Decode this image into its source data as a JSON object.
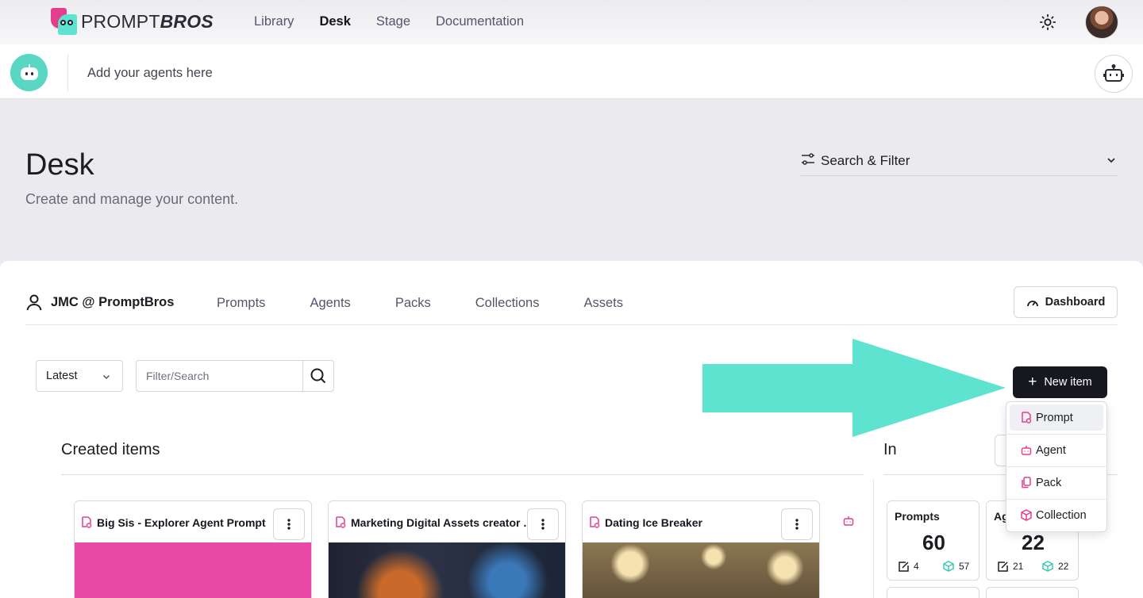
{
  "brand": {
    "name_light": "PROMPT",
    "name_bold": "BROS"
  },
  "nav": {
    "links": [
      "Library",
      "Desk",
      "Stage",
      "Documentation"
    ],
    "active": "Desk"
  },
  "agent_bar": {
    "placeholder": "Add your agents here"
  },
  "page": {
    "title": "Desk",
    "subtitle": "Create and manage your content."
  },
  "search_filter": {
    "label": "Search & Filter"
  },
  "owner": {
    "name": "JMC @ PromptBros"
  },
  "tabs": [
    "Prompts",
    "Agents",
    "Packs",
    "Collections",
    "Assets"
  ],
  "dashboard": {
    "label": "Dashboard"
  },
  "toolbar": {
    "sort_value": "Latest",
    "search_placeholder": "Filter/Search",
    "new_item_label": "New item"
  },
  "new_item_menu": {
    "items": [
      "Prompt",
      "Agent",
      "Pack",
      "Collection"
    ],
    "highlighted": "Prompt"
  },
  "colors": {
    "accent": "#5de3d0",
    "brand_pink": "#e43f8f",
    "dark_button": "#17171f"
  },
  "sections": {
    "created": "Created items",
    "in": "In"
  },
  "cards": [
    {
      "title": "Big Sis - Explorer Agent Prompt"
    },
    {
      "title": "Marketing Digital Assets creator Assistant"
    },
    {
      "title": "Dating Ice Breaker"
    }
  ],
  "stats": [
    {
      "label": "Prompts",
      "value": "60",
      "a": "4",
      "b": "57"
    },
    {
      "label": "Ag",
      "value": "22",
      "a": "21",
      "b": "22"
    }
  ]
}
